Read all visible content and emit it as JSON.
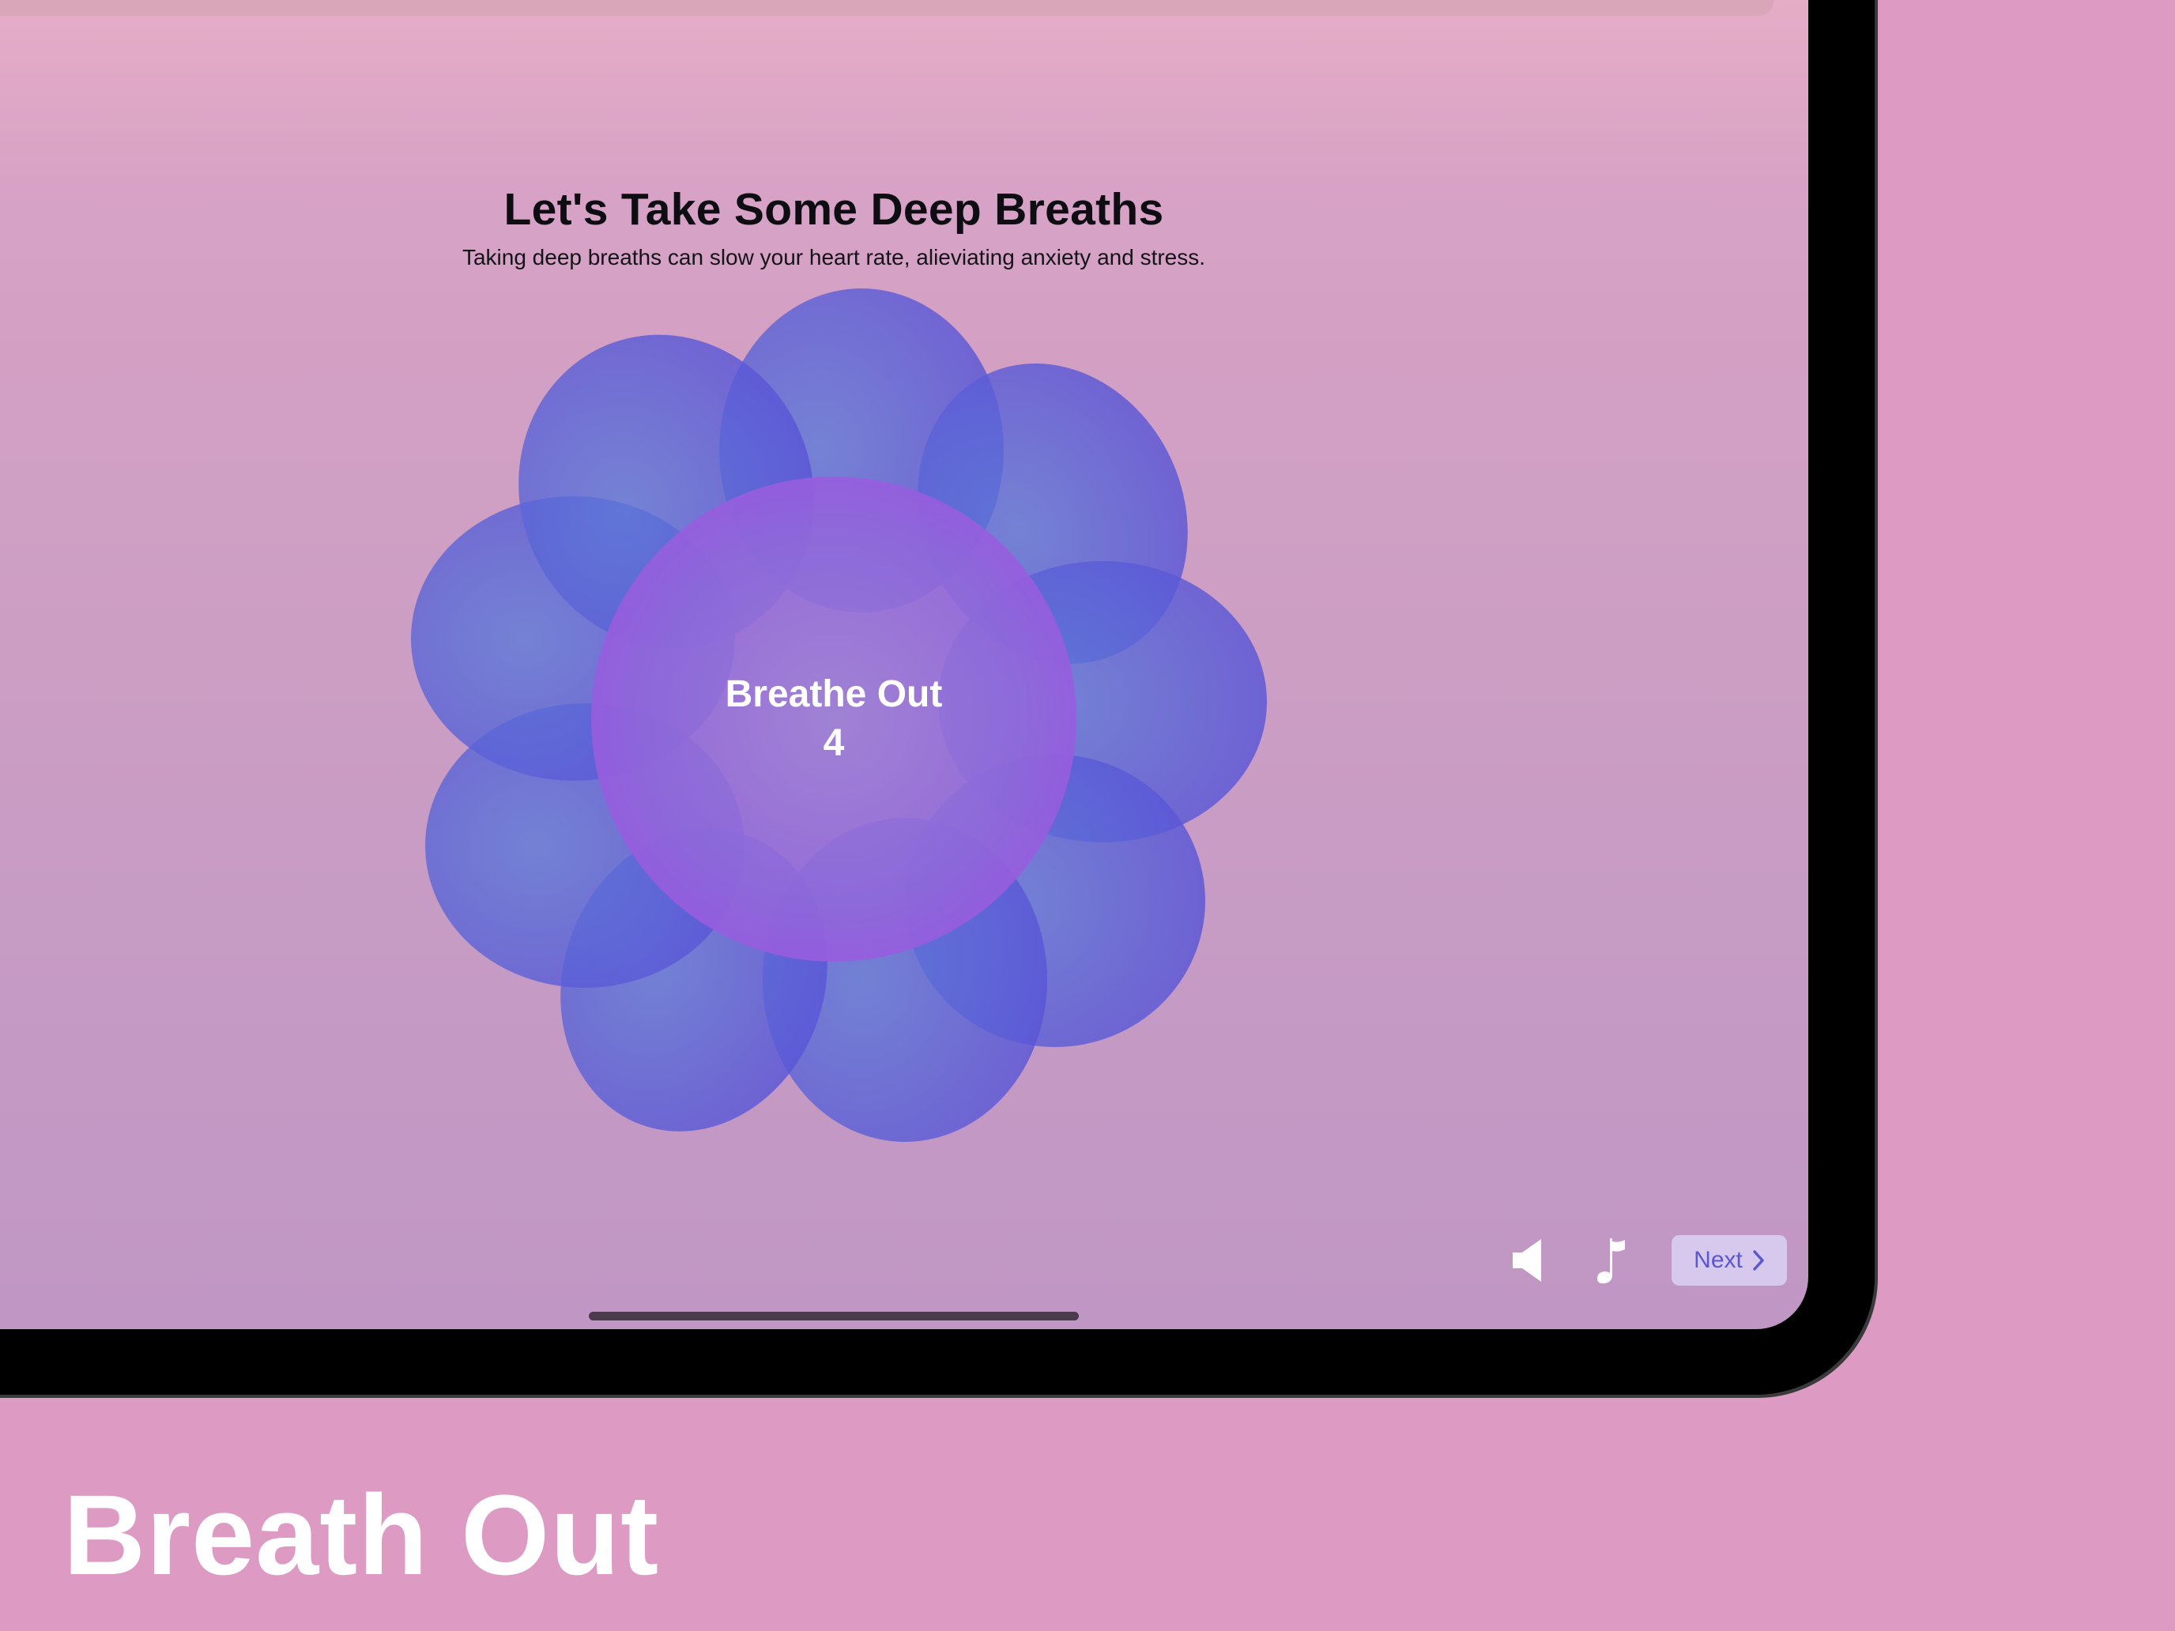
{
  "screen": {
    "title": "Let's Take Some Deep Breaths",
    "subtitle": "Taking deep breaths can slow your heart rate, alieviating anxiety and stress."
  },
  "breathing": {
    "phase": "Breathe Out",
    "count": "4"
  },
  "controls": {
    "sound_icon": "speaker-icon",
    "music_icon": "music-note-icon",
    "next_label": "Next",
    "next_icon": "chevron-right-icon"
  },
  "caption": "Breath Out",
  "colors": {
    "background": "#dd9bc3",
    "petal": "#5b57d8",
    "center": "#9a5ee0",
    "next_text": "#5b57d3"
  }
}
